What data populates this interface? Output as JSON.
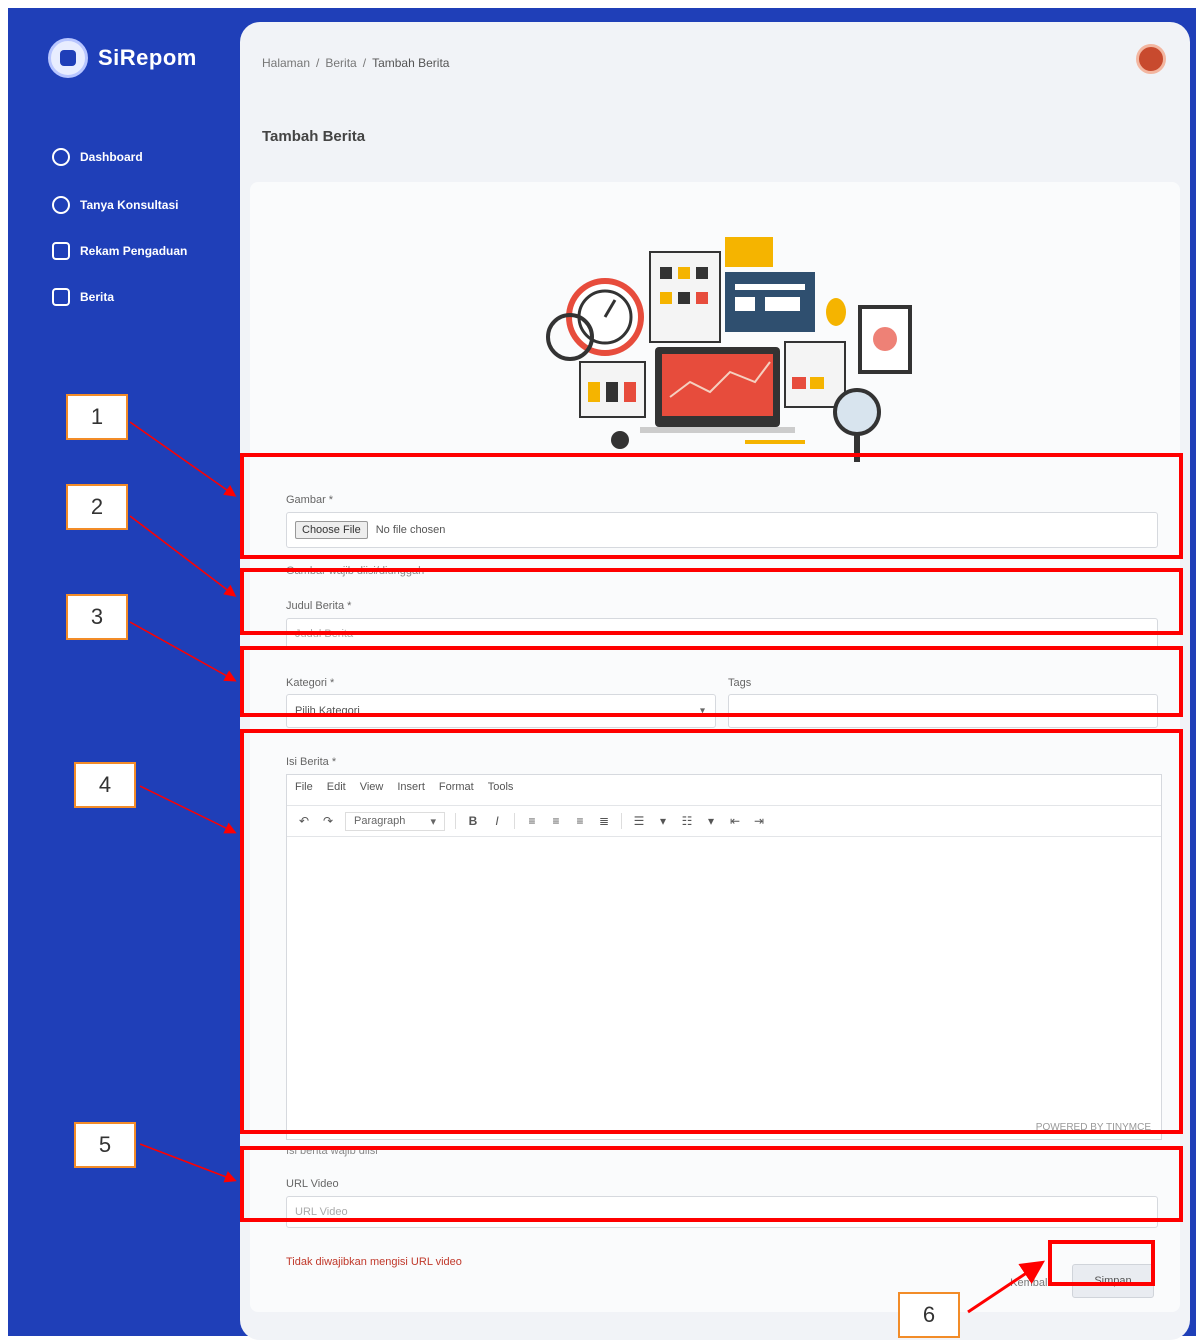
{
  "sidebar": {
    "brand_name": "SiRepom",
    "items": [
      {
        "label": "Dashboard",
        "icon": "dashboard-icon"
      },
      {
        "label": "Tanya Konsultasi",
        "icon": "chat-icon"
      },
      {
        "label": "Rekam Pengaduan",
        "icon": "record-icon"
      },
      {
        "label": "Berita",
        "icon": "news-icon"
      }
    ],
    "background_color": "#1f3fb8"
  },
  "header": {
    "breadcrumb": [
      "Halaman",
      "Berita",
      "Tambah Berita"
    ]
  },
  "page": {
    "title": "Tambah Berita"
  },
  "form": {
    "thumbnail": {
      "label": "Gambar *",
      "file_button": "Choose File",
      "file_status": "No file chosen",
      "hint": "Gambar wajib diisi/diunggah"
    },
    "title": {
      "label": "Judul Berita *",
      "placeholder": "Judul Berita"
    },
    "category": {
      "label": "Kategori *",
      "selected": "Pilih Kategori",
      "tags_label": "Tags"
    },
    "content": {
      "label": "Isi Berita *",
      "menu": [
        "File",
        "Edit",
        "View",
        "Insert",
        "Format",
        "Tools"
      ],
      "format_select": "Paragraph",
      "hint": "Isi berita wajib diisi",
      "statusbar": "POWERED BY TINYMCE"
    },
    "url": {
      "label": "URL Video",
      "placeholder": "URL Video",
      "hint": "Tidak diwajibkan mengisi URL video"
    },
    "buttons": {
      "cancel": "Kembali",
      "save": "Simpan"
    }
  },
  "annotations": [
    "1",
    "2",
    "3",
    "4",
    "5",
    "6"
  ],
  "annotation_color": "#ff0000",
  "annotation_label_border": "#f28c28"
}
